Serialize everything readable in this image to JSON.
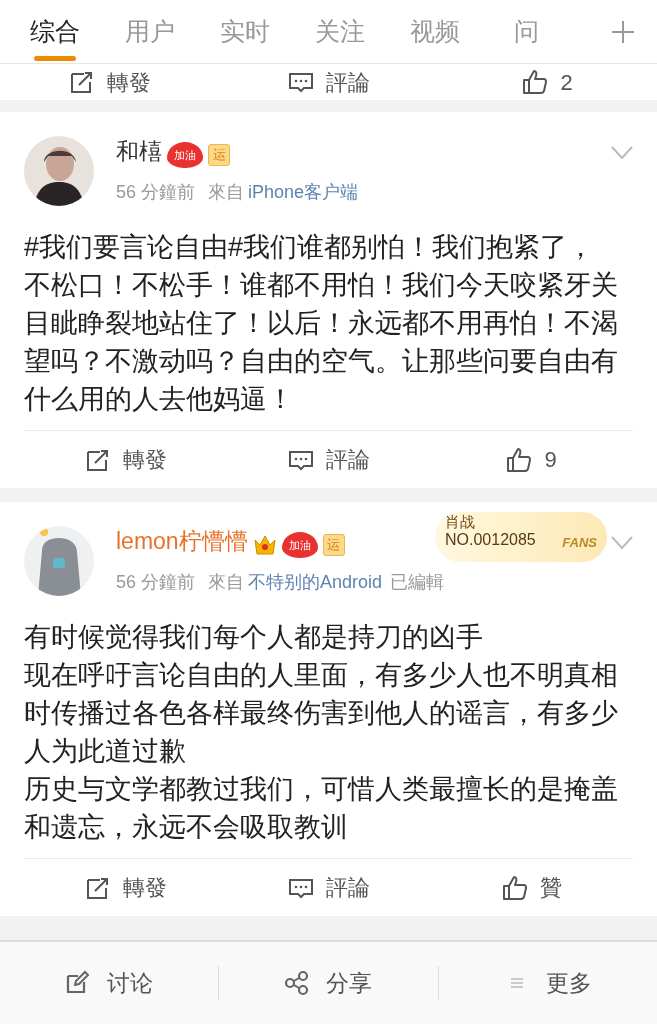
{
  "tabs": [
    {
      "label": "综合",
      "selected": true
    },
    {
      "label": "用户",
      "selected": false
    },
    {
      "label": "实时",
      "selected": false
    },
    {
      "label": "关注",
      "selected": false
    },
    {
      "label": "视频",
      "selected": false
    },
    {
      "label": "问",
      "selected": false
    }
  ],
  "previous_post_actions": {
    "repost": "轉發",
    "comment": "評論",
    "like": "2"
  },
  "posts": [
    {
      "author": "和橲",
      "vip": false,
      "badges": [
        {
          "kind": "heart",
          "text": "加油"
        },
        {
          "kind": "square",
          "text": "运"
        }
      ],
      "time": "56 分鐘前",
      "from_label": "來自",
      "source": "iPhone客户端",
      "paragraphs": [
        "#我们要言论自由#我们谁都别怕！我们抱紧了，不松口！不松手！谁都不用怕！我们今天咬紧牙关目眦睁裂地站住了！以后！永远都不用再怕！不渴望吗？不激动吗？自由的空气。让那些问要自由有什么用的人去他妈逼！"
      ],
      "actions": {
        "repost": "轉發",
        "comment": "評論",
        "like": "9"
      }
    },
    {
      "author": "lemon柠懵懵",
      "vip": true,
      "badges": [
        {
          "kind": "crown"
        },
        {
          "kind": "heart",
          "text": "加油"
        },
        {
          "kind": "square",
          "text": "运"
        }
      ],
      "fans_badge": {
        "name": "肖战",
        "number": "NO.0012085",
        "label": "FANS"
      },
      "time": "56 分鐘前",
      "from_label": "來自",
      "source": "不特别的Android",
      "edited": "已編輯",
      "paragraphs": [
        "有时候觉得我们每个人都是持刀的凶手",
        "现在呼吁言论自由的人里面，有多少人也不明真相时传播过各色各样最终伤害到他人的谣言，有多少人为此道过歉",
        "历史与文学都教过我们，可惜人类最擅长的是掩盖和遗忘，永远不会吸取教训"
      ],
      "actions": {
        "repost": "轉發",
        "comment": "評論",
        "like": "贊"
      }
    }
  ],
  "bottom_bar": [
    {
      "kind": "edit",
      "label": "讨论"
    },
    {
      "kind": "share",
      "label": "分享"
    },
    {
      "kind": "more",
      "label": "更多"
    }
  ]
}
